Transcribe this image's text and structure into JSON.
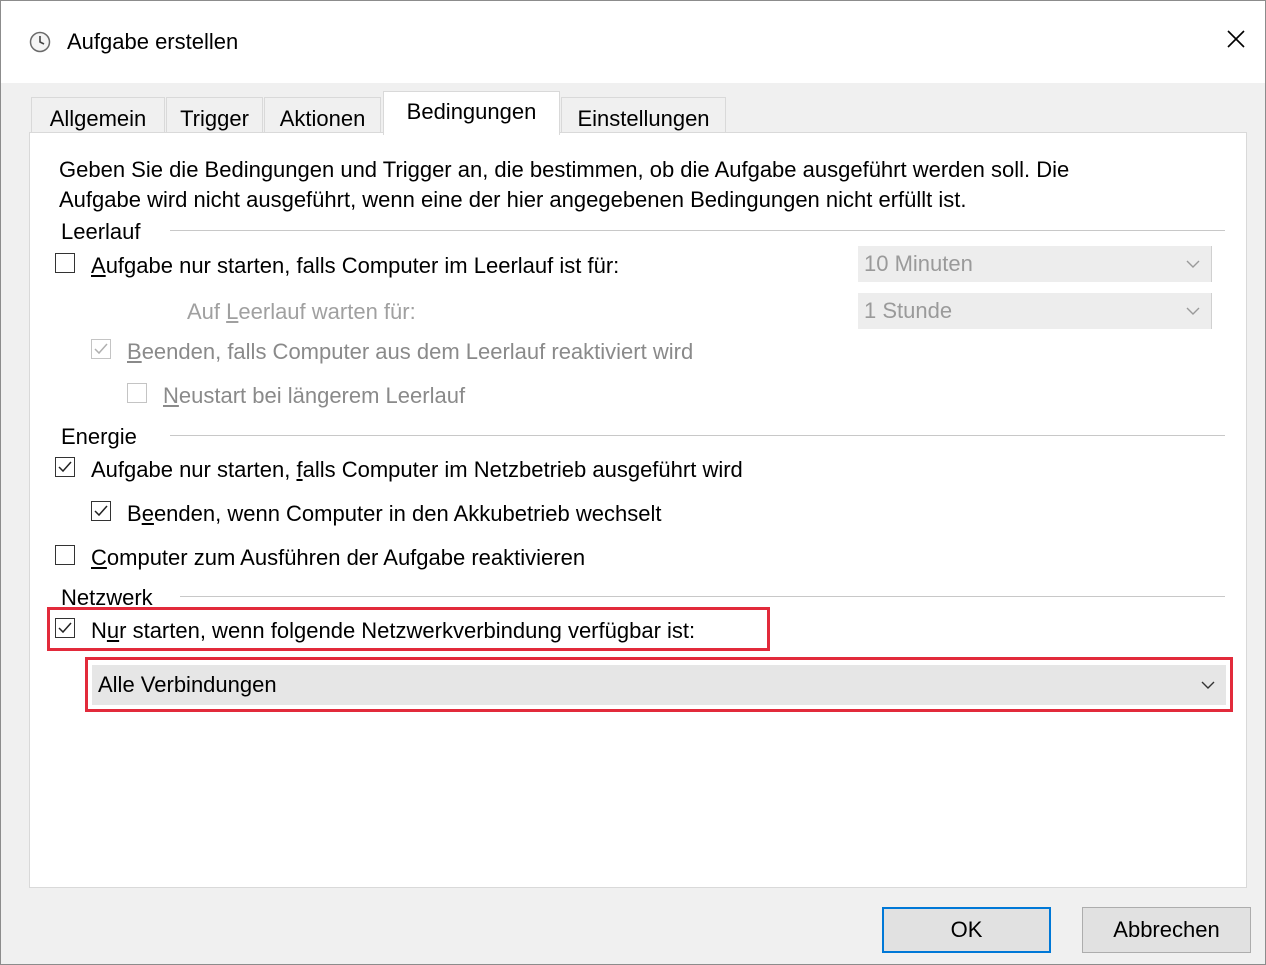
{
  "window": {
    "title": "Aufgabe erstellen",
    "close_glyph": "✕"
  },
  "tabs": [
    {
      "label": "Allgemein",
      "active": false
    },
    {
      "label": "Trigger",
      "active": false
    },
    {
      "label": "Aktionen",
      "active": false
    },
    {
      "label": "Bedingungen",
      "active": true
    },
    {
      "label": "Einstellungen",
      "active": false
    }
  ],
  "intro": {
    "line1": "Geben Sie die Bedingungen und Trigger an, die bestimmen, ob die Aufgabe ausgeführt werden soll. Die",
    "line2": "Aufgabe wird nicht ausgeführt, wenn eine der hier angegebenen Bedingungen nicht erfüllt ist."
  },
  "idle": {
    "heading": "Leerlauf",
    "start_if_idle": {
      "pre": "",
      "key": "A",
      "post": "ufgabe nur starten, falls Computer im Leerlauf ist für:",
      "checked": false,
      "enabled": true
    },
    "idle_duration": {
      "value": "10 Minuten",
      "enabled": false
    },
    "wait_label": {
      "pre": "Auf ",
      "key": "L",
      "post": "eerlauf warten für:"
    },
    "wait_duration": {
      "value": "1 Stunde",
      "enabled": false
    },
    "stop_on_resume": {
      "pre": "",
      "key": "B",
      "post": "eenden, falls Computer aus dem Leerlauf reaktiviert wird",
      "checked": true,
      "enabled": false
    },
    "restart_on_idle": {
      "pre": "",
      "key": "N",
      "post": "eustart bei längerem Leerlauf",
      "checked": false,
      "enabled": false
    }
  },
  "power": {
    "heading": "Energie",
    "ac_only": {
      "pre": "Aufgabe nur starten, ",
      "key": "f",
      "post": "alls Computer im Netzbetrieb ausgeführt wird",
      "checked": true
    },
    "stop_on_battery": {
      "pre": "B",
      "key": "e",
      "post": "enden, wenn Computer in den Akkubetrieb wechselt",
      "checked": true
    },
    "wake": {
      "pre": "",
      "key": "C",
      "post": "omputer zum Ausführen der Aufgabe reaktivieren",
      "checked": false
    }
  },
  "network": {
    "heading": "Netzwerk",
    "require_network": {
      "pre": "N",
      "key": "u",
      "post": "r starten, wenn folgende Netzwerkverbindung verfügbar ist:",
      "checked": true
    },
    "connection": {
      "value": "Alle Verbindungen"
    }
  },
  "buttons": {
    "ok": "OK",
    "cancel": "Abbrechen"
  },
  "colors": {
    "highlight": "#e22a3b",
    "default_button_border": "#0078d7"
  }
}
